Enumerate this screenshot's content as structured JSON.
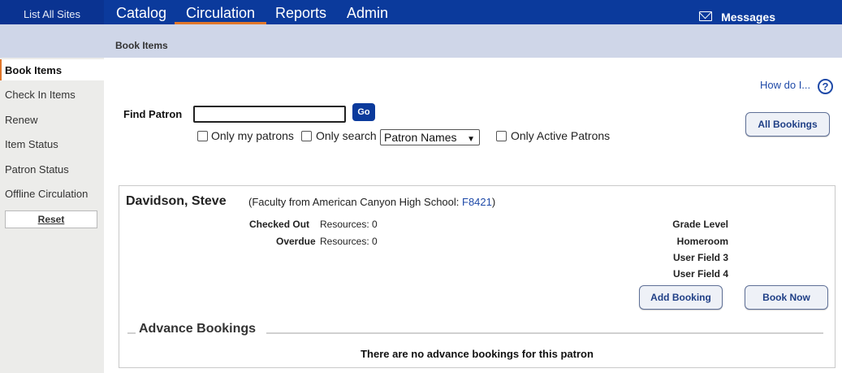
{
  "topnav": {
    "list_sites": "List All Sites",
    "tabs": [
      {
        "label": "Catalog"
      },
      {
        "label": "Circulation"
      },
      {
        "label": "Reports"
      },
      {
        "label": "Admin"
      }
    ],
    "active_tab": "Circulation",
    "messages": "Messages"
  },
  "subheader": {
    "title": "Book Items"
  },
  "sidebar": {
    "items": [
      {
        "label": "Book Items",
        "active": true
      },
      {
        "label": "Check In Items"
      },
      {
        "label": "Renew"
      },
      {
        "label": "Item Status"
      },
      {
        "label": "Patron Status"
      },
      {
        "label": "Offline Circulation"
      }
    ],
    "reset": "Reset"
  },
  "help": {
    "label": "How do I...",
    "icon": "?"
  },
  "find": {
    "label": "Find Patron",
    "value": "",
    "go": "Go",
    "only_my_patrons": "Only my patrons",
    "only_search": "Only search",
    "search_scope": "Patron Names",
    "only_active": "Only Active Patrons"
  },
  "buttons": {
    "all_bookings": "All Bookings",
    "add_booking": "Add Booking",
    "book_now": "Book Now"
  },
  "patron": {
    "name": "Davidson, Steve",
    "sub_prefix": "(Faculty from American Canyon High School: ",
    "barcode": "F8421",
    "sub_suffix": ")",
    "checked_out_label": "Checked Out",
    "checked_out_value": "Resources: 0",
    "overdue_label": "Overdue",
    "overdue_value": "Resources: 0",
    "grade_level": "Grade Level",
    "homeroom": "Homeroom",
    "user_field_3": "User Field 3",
    "user_field_4": "User Field 4"
  },
  "advance": {
    "title": "Advance Bookings",
    "empty": "There are no advance bookings for this patron"
  },
  "colors": {
    "nav_bg": "#0b3a9c",
    "accent": "#e0762a",
    "link": "#1f4aa8",
    "subheader_bg": "#cfd6e8",
    "sidebar_bg": "#ececea"
  }
}
